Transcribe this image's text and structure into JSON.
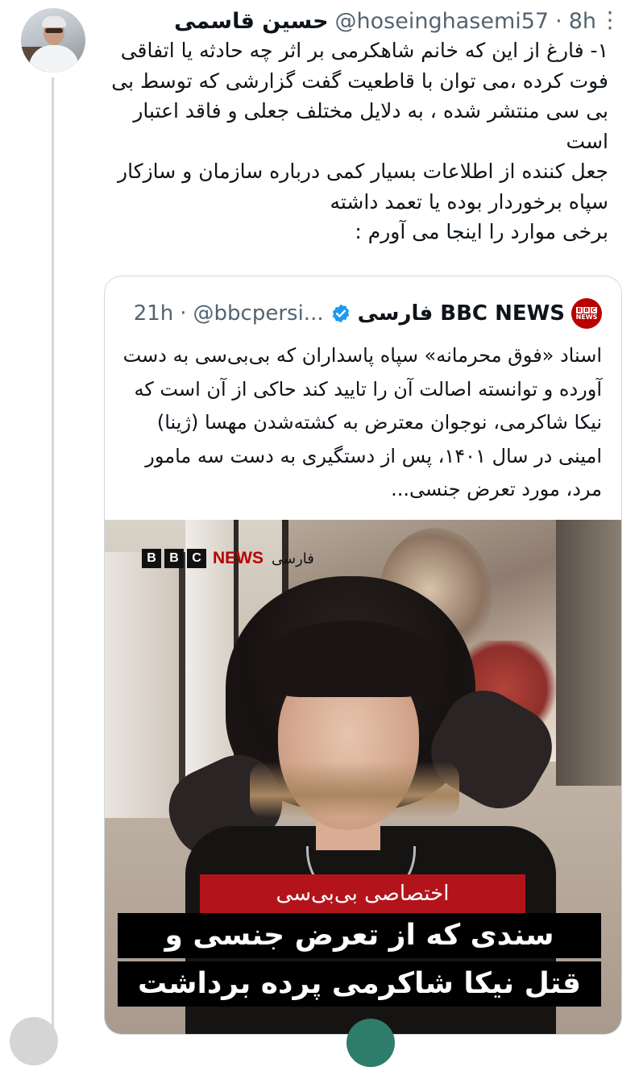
{
  "tweet": {
    "author_name": "حسین قاسمی",
    "handle": "@hoseinghasemi57",
    "separator": "·",
    "time": "8h",
    "text_lines": [
      "۱- فارغ از این که خانم شاهکرمی بر اثر چه حادثه یا اتفاقی فوت کرده ،می توان با قاطعیت گفت گزارشی که توسط بی بی سی منتشر شده ، به دلایل مختلف جعلی و فاقد اعتبار است",
      "جعل کننده از اطلاعات بسیار کمی درباره سازمان و سازکار سپاه برخوردار بوده یا تعمد داشته",
      "برخی موارد را اینجا می آورم :"
    ]
  },
  "quote": {
    "logo_text": "BBC NEWS",
    "author_name": "BBC NEWS فارسی",
    "handle": "@bbcpersi...",
    "separator": "·",
    "time": "21h",
    "text_lines": [
      "اسناد «فوق محرمانه» سپاه پاسداران که بی‌بی‌سی به دست آورده و توانسته اصالت آن را تایید کند حاکی از آن است که نیکا شاکرمی، نوجوان معترض به کشته‌شدن مهسا (ژینا) امینی در سال ۱۴۰۱، پس از دستگیری به دست سه مامور مرد، مورد تعرض جنسی..."
    ],
    "image": {
      "brand_blocks": [
        "B",
        "B",
        "C"
      ],
      "brand_news": "NEWS",
      "brand_farsi": "فارسی",
      "banner_text": "اختصاصی بی‌بی‌سی",
      "headline_lines": [
        "سندی که از تعرض جنسی و",
        "قتل نیکا شاکرمی پرده برداشت"
      ]
    }
  },
  "icons": {
    "more": "more-options-icon",
    "verified": "verified-badge-icon"
  },
  "colors": {
    "text": "#0f1419",
    "secondary": "#536471",
    "verified": "#1d9bf0",
    "bbc_red": "#b80000",
    "banner_red": "#b3141b"
  }
}
